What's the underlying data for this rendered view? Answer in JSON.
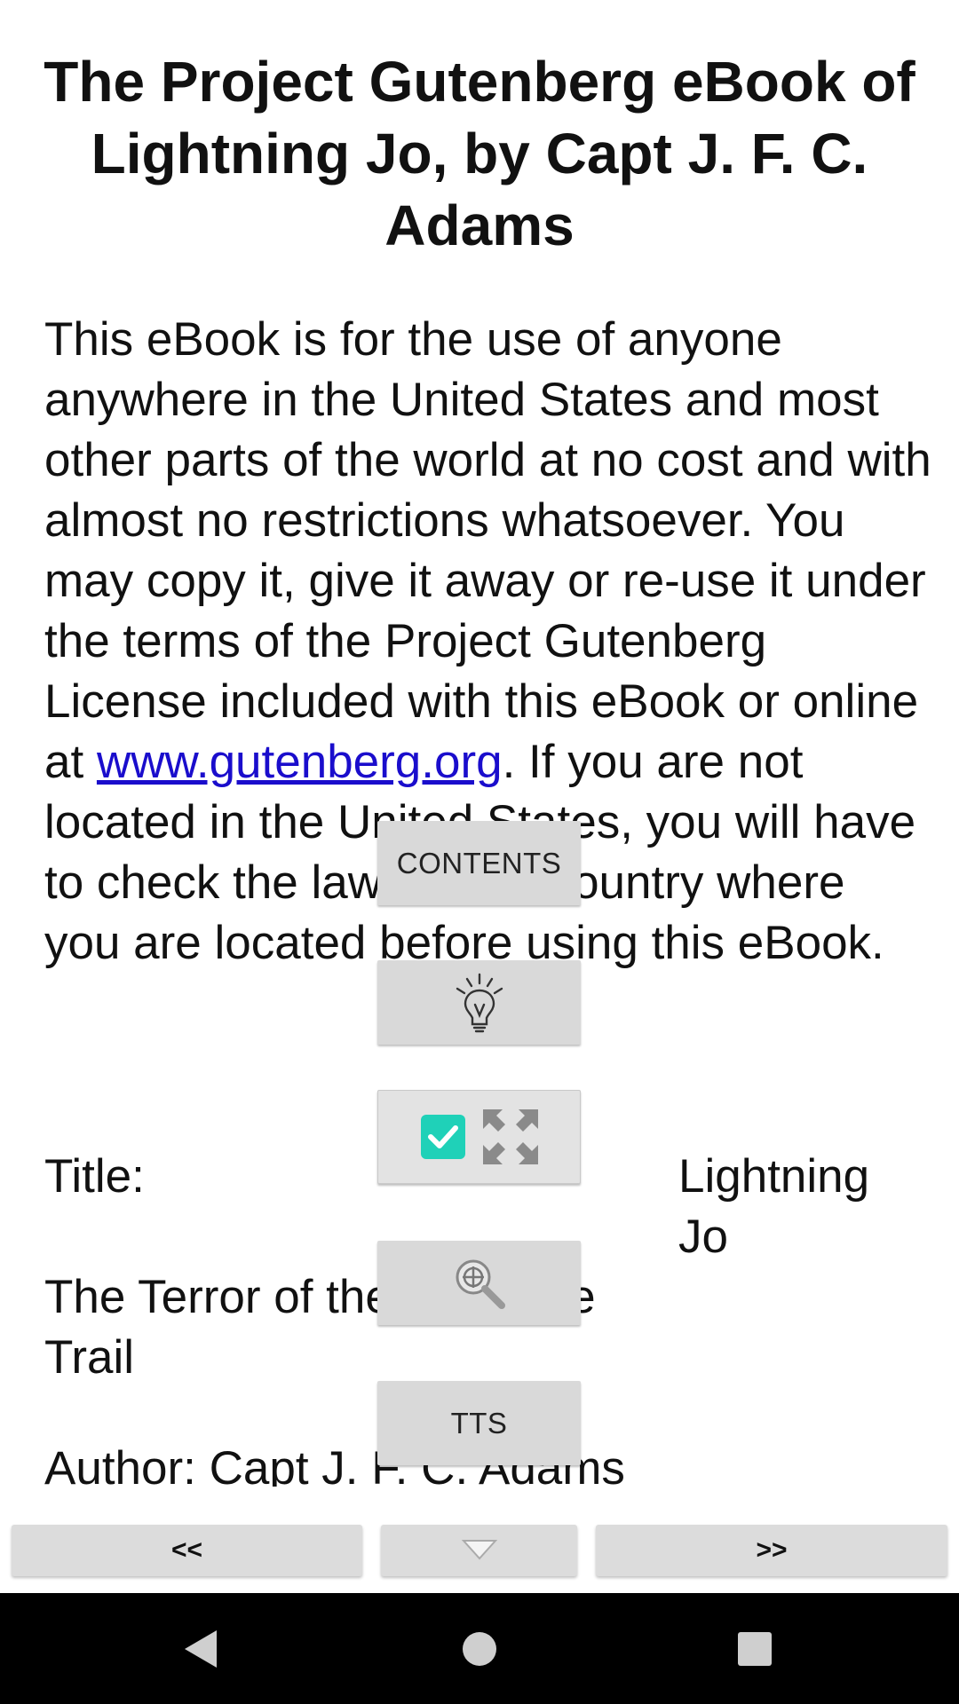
{
  "book": {
    "title": "The Project Gutenberg eBook of Lightning Jo, by Capt J. F. C. Adams",
    "paragraph_before_link": "This eBook is for the use of anyone anywhere in the United States and most other parts of the world at no cost and with almost no restrictions whatsoever. You may copy it, give it away or re-use it under the terms of the Project Gutenberg License included with this eBook or online at ",
    "link_text": "www.gutenberg.org",
    "paragraph_after_link": ". If you are not located in the United States, you will have to check the laws of the country where you are located before using this eBook.",
    "title_label": "Title:",
    "title_value": "Lightning Jo",
    "subtitle": "The Terror of the Santa Fe Trail",
    "author": "Author: Capt J. F. C. Adams"
  },
  "overlay": {
    "contents_label": "CONTENTS",
    "brightness_icon": "lightbulb-icon",
    "fullscreen_checked": true,
    "fullscreen_icon": "fullscreen-icon",
    "zoom_icon": "zoom-icon",
    "tts_label": "TTS"
  },
  "nav": {
    "prev_label": "<<",
    "menu_icon": "triangle-down-icon",
    "next_label": ">>"
  },
  "system_nav": {
    "back_icon": "back-icon",
    "home_icon": "home-icon",
    "recents_icon": "recents-icon"
  },
  "colors": {
    "link": "#1a0dcc",
    "checkbox": "#1fd1b8",
    "button_bg": "#d9d9d9",
    "system_bar": "#000000"
  }
}
